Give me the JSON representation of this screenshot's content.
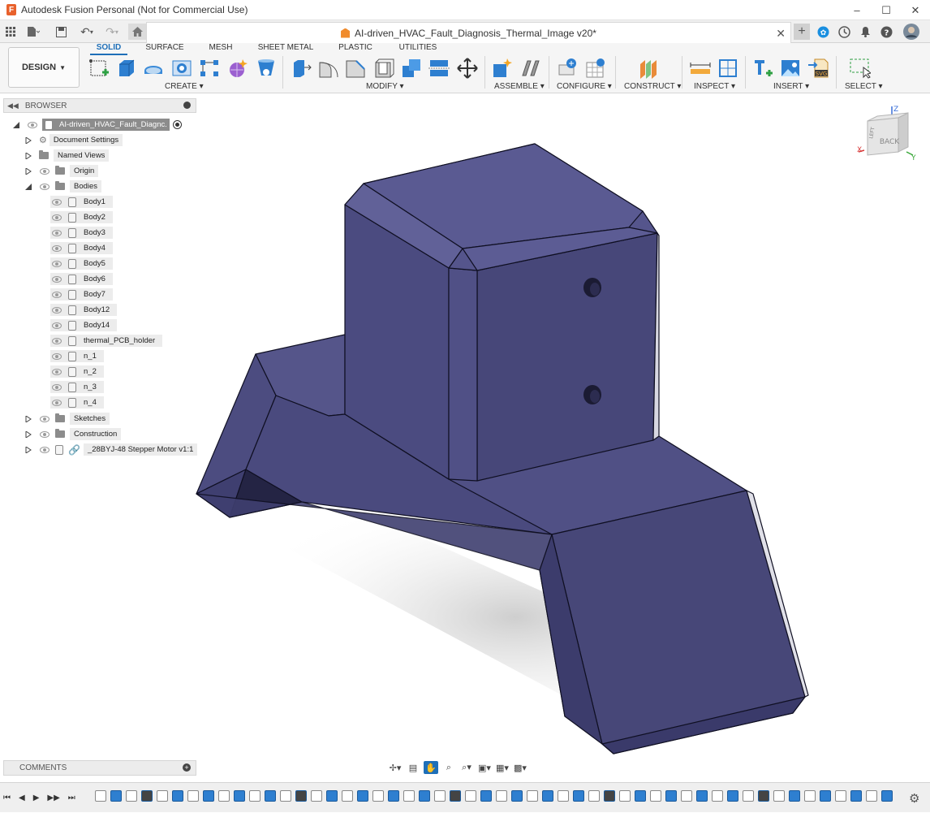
{
  "window": {
    "title": "Autodesk Fusion Personal (Not for Commercial Use)",
    "minimize_icon": "minimize-icon",
    "maximize_icon": "maximize-icon",
    "close_icon": "close-icon"
  },
  "document_tab": {
    "title": "AI-driven_HVAC_Fault_Diagnosis_Thermal_Image v20*"
  },
  "workspace": {
    "mode_label": "DESIGN"
  },
  "ribbon": {
    "tabs": [
      {
        "label": "SOLID",
        "active": true
      },
      {
        "label": "SURFACE",
        "active": false
      },
      {
        "label": "MESH",
        "active": false
      },
      {
        "label": "SHEET METAL",
        "active": false
      },
      {
        "label": "PLASTIC",
        "active": false
      },
      {
        "label": "UTILITIES",
        "active": false
      }
    ],
    "groups": [
      {
        "label": "CREATE"
      },
      {
        "label": "MODIFY"
      },
      {
        "label": "ASSEMBLE"
      },
      {
        "label": "CONFIGURE"
      },
      {
        "label": "CONSTRUCT"
      },
      {
        "label": "INSPECT"
      },
      {
        "label": "INSERT"
      },
      {
        "label": "SELECT"
      }
    ]
  },
  "browser": {
    "title": "BROWSER",
    "root": "AI-driven_HVAC_Fault_Diagnc...",
    "items": [
      {
        "label": "Document Settings"
      },
      {
        "label": "Named Views"
      },
      {
        "label": "Origin"
      },
      {
        "label": "Bodies"
      },
      {
        "label": "Body1"
      },
      {
        "label": "Body2"
      },
      {
        "label": "Body3"
      },
      {
        "label": "Body4"
      },
      {
        "label": "Body5"
      },
      {
        "label": "Body6"
      },
      {
        "label": "Body7"
      },
      {
        "label": "Body12"
      },
      {
        "label": "Body14"
      },
      {
        "label": "thermal_PCB_holder"
      },
      {
        "label": "n_1"
      },
      {
        "label": "n_2"
      },
      {
        "label": "n_3"
      },
      {
        "label": "n_4"
      },
      {
        "label": "Sketches"
      },
      {
        "label": "Construction"
      },
      {
        "label": "_28BYJ-48 Stepper Motor v1:1"
      }
    ]
  },
  "comments": {
    "label": "COMMENTS"
  },
  "viewcube": {
    "face_label": "BACK",
    "side_label": "LEFT",
    "axis_x": "X",
    "axis_y": "Y",
    "axis_z": "Z"
  },
  "colors": {
    "model_face": "#4a4a7c",
    "model_dark": "#2e2e55",
    "accent_blue": "#1e6fb8",
    "doc_orange": "#f08b2c"
  }
}
